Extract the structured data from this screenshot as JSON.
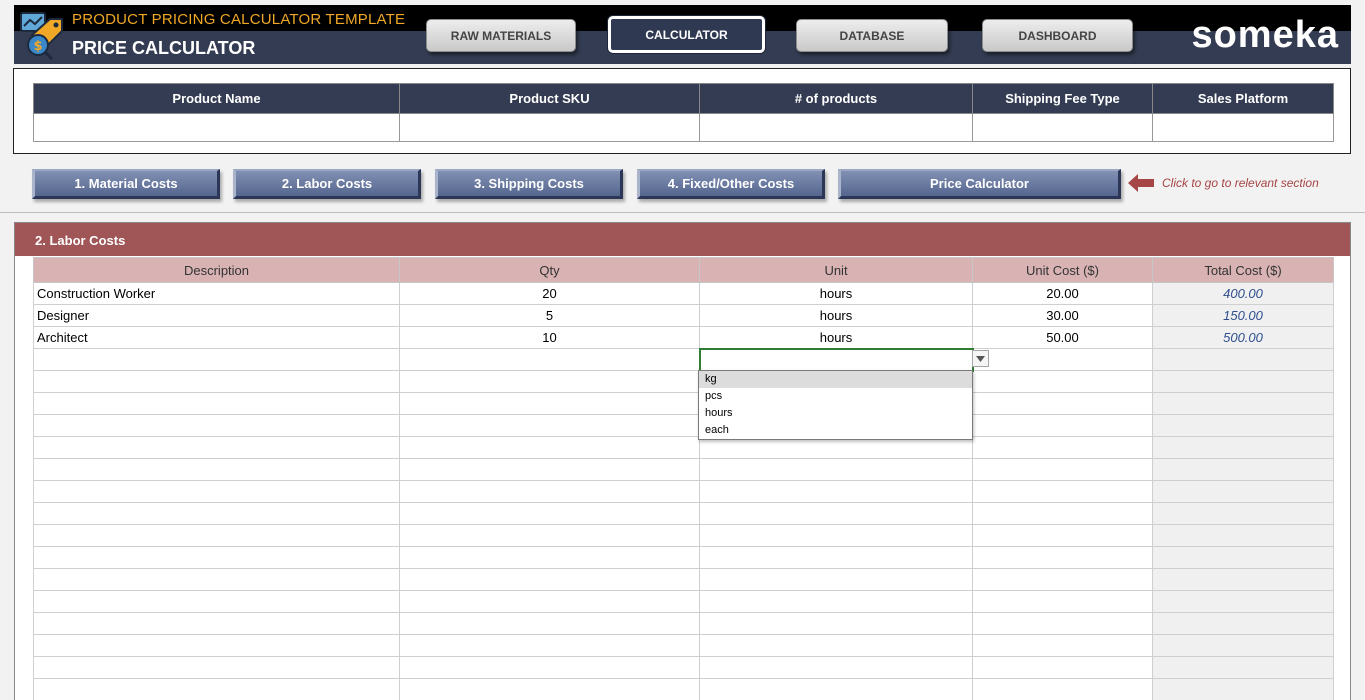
{
  "header": {
    "subtitle": "PRODUCT PRICING CALCULATOR TEMPLATE",
    "title": "PRICE CALCULATOR",
    "brand": "someka",
    "nav": [
      {
        "label": "RAW MATERIALS",
        "active": false
      },
      {
        "label": "CALCULATOR",
        "active": true
      },
      {
        "label": "DATABASE",
        "active": false
      },
      {
        "label": "DASHBOARD",
        "active": false
      }
    ]
  },
  "product_info": {
    "columns": [
      "Product Name",
      "Product SKU",
      "# of products",
      "Shipping Fee Type",
      "Sales Platform"
    ],
    "values": [
      "",
      "",
      "",
      "",
      ""
    ]
  },
  "sections": {
    "buttons": [
      "1. Material Costs",
      "2. Labor Costs",
      "3. Shipping Costs",
      "4. Fixed/Other Costs",
      "Price Calculator"
    ],
    "hint": "Click to go to relevant section"
  },
  "labor": {
    "title": "2. Labor Costs",
    "columns": [
      "Description",
      "Qty",
      "Unit",
      "Unit Cost ($)",
      "Total Cost ($)"
    ],
    "rows": [
      {
        "description": "Construction Worker",
        "qty": "20",
        "unit": "hours",
        "unit_cost": "20.00",
        "total": "400.00"
      },
      {
        "description": "Designer",
        "qty": "5",
        "unit": "hours",
        "unit_cost": "30.00",
        "total": "150.00"
      },
      {
        "description": "Architect",
        "qty": "10",
        "unit": "hours",
        "unit_cost": "50.00",
        "total": "500.00"
      }
    ],
    "empty_rows": 16,
    "unit_dropdown": {
      "options": [
        "kg",
        "pcs",
        "hours",
        "each"
      ],
      "highlighted": "kg"
    }
  },
  "colors": {
    "header_bg": "#333c52",
    "subtitle": "#f0a826",
    "section_header": "#a05656",
    "table_header": "#d9b3b3",
    "total_text": "#2f4f8f",
    "hint_text": "#a64545"
  }
}
